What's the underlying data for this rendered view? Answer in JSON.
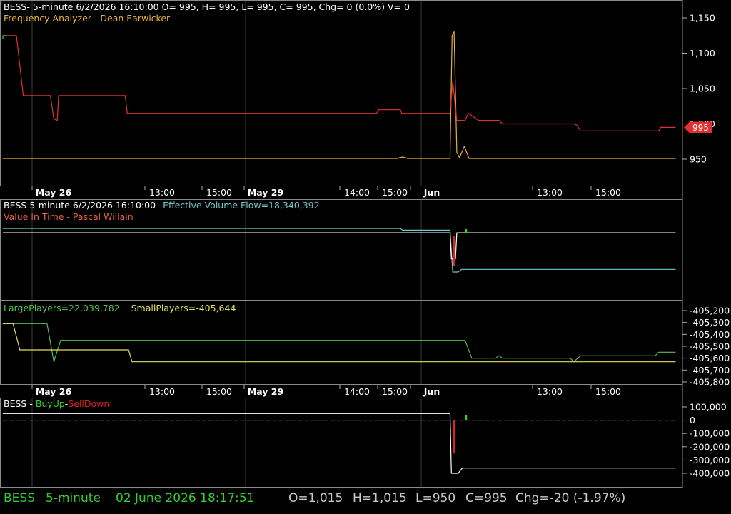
{
  "colors": {
    "background": "#000000",
    "frame": "#8a8a8a",
    "grid": "#3a3a3a",
    "price": "#e03030",
    "freq": "#e8b040",
    "evf": "#70c8c8",
    "vit": "#e03030",
    "large": "#50c050",
    "small": "#e0e060",
    "buy": "#30d030",
    "sell": "#e02020",
    "white": "#ffffff",
    "status_green": "#33cc33",
    "status_gray": "#c8c8c8"
  },
  "panels": {
    "price": {
      "header": "BESS- 5-minute 6/2/2026 16:10:00 O= 995, H= 995, L= 995, C= 995, Chg= 0 (0.0%) V= 0",
      "indicator": "Frequency Analyzer - Dean Earwicker",
      "y_ticks": [
        "1,150",
        "1,100",
        "1,050",
        "1,000",
        "950"
      ],
      "last_price": "995"
    },
    "flow": {
      "header_prefix": "BESS 5-minute  6/2/2026 16:10:00",
      "evf": "Effective Volume Flow=18,340,392",
      "vit": "Value In Time - Pascal Willain"
    },
    "players": {
      "large": "LargePlayers=22,039,782",
      "small": "SmallPlayers=-405,644",
      "y_ticks": [
        "-405,200",
        "-405,300",
        "-405,400",
        "-405,500",
        "-405,600",
        "-405,700",
        "-405,800"
      ]
    },
    "buysell": {
      "prefix": "BESS - ",
      "buy": "BuyUp",
      "dash": "-",
      "sell": "SellDown",
      "y_ticks": [
        "100,000",
        "0",
        "-100,000",
        "-200,000",
        "-300,000",
        "-400,000"
      ]
    }
  },
  "time_axis": [
    "May 26",
    "13:00",
    "15:00",
    "May 29",
    "14:00",
    "15:00",
    "Jun",
    "13:00",
    "15:00"
  ],
  "status": {
    "symbol": "BESS",
    "interval": "5-minute",
    "datetime": "02 June 2026 18:17:51",
    "open": "O=1,015",
    "high": "H=1,015",
    "low": "L=950",
    "close": "C=995",
    "change": "Chg=-20 (-1.97%)"
  },
  "chart_data": [
    {
      "type": "line",
      "title": "BESS- 5-minute 6/2/2026 16:10:00 O= 995, H= 995, L= 995, C= 995, Chg= 0 (0.0%) V= 0",
      "x_labels": [
        "May 26",
        "13:00",
        "15:00",
        "May 29",
        "14:00",
        "15:00",
        "Jun",
        "13:00",
        "15:00"
      ],
      "ylim": [
        925,
        1175
      ],
      "y_ticks": [
        1150,
        1100,
        1050,
        1000,
        950
      ],
      "series": [
        {
          "name": "BESS",
          "points": [
            [
              0,
              1125
            ],
            [
              2,
              1125
            ],
            [
              3,
              1040
            ],
            [
              7,
              1040
            ],
            [
              7.5,
              1007
            ],
            [
              8,
              1005
            ],
            [
              8.2,
              1040
            ],
            [
              18,
              1040
            ],
            [
              18.3,
              1015
            ],
            [
              55,
              1015
            ],
            [
              55.3,
              1020
            ],
            [
              58.5,
              1020
            ],
            [
              58.7,
              1015
            ],
            [
              65.8,
              1015
            ],
            [
              66.2,
              1060
            ],
            [
              66.8,
              1005
            ],
            [
              68,
              1005
            ],
            [
              68.5,
              1015
            ],
            [
              70,
              1005
            ],
            [
              73,
              1005
            ],
            [
              73.5,
              1000
            ],
            [
              84,
              1000
            ],
            [
              84.5,
              998
            ],
            [
              85,
              990
            ],
            [
              96.5,
              990
            ],
            [
              96.8,
              995
            ],
            [
              99,
              995
            ]
          ]
        },
        {
          "name": "Frequency Analyzer - Dean Earwicker",
          "points": [
            [
              0,
              951
            ],
            [
              58,
              951
            ],
            [
              58.8,
              953
            ],
            [
              59.6,
              951
            ],
            [
              65.8,
              951
            ],
            [
              66.1,
              1125
            ],
            [
              66.4,
              1130
            ],
            [
              66.8,
              960
            ],
            [
              67.2,
              952
            ],
            [
              67.9,
              968
            ],
            [
              68.6,
              951
            ],
            [
              99,
              951
            ]
          ]
        }
      ]
    },
    {
      "type": "line",
      "title": "BESS 5-minute  6/2/2026 16:10:00",
      "series": [
        {
          "name": "Effective Volume Flow=18,340,392",
          "points": [
            [
              0,
              18.55
            ],
            [
              58.5,
              18.55
            ],
            [
              58.8,
              18.53
            ],
            [
              65.8,
              18.53
            ],
            [
              66.2,
              18.05
            ],
            [
              67,
              18.05
            ],
            [
              67.5,
              18.08
            ],
            [
              99,
              18.08
            ]
          ]
        },
        {
          "name": "Value In Time - Pascal Willain",
          "points": [
            [
              0,
              18.5
            ],
            [
              65.8,
              18.5
            ],
            [
              66,
              18.2
            ],
            [
              66.6,
              18.2
            ],
            [
              66.8,
              18.5
            ],
            [
              99,
              18.5
            ]
          ]
        }
      ]
    },
    {
      "type": "line",
      "title": "LargePlayers / SmallPlayers",
      "ylim": [
        -405835,
        -405165
      ],
      "y_ticks": [
        -405200,
        -405300,
        -405400,
        -405500,
        -405600,
        -405700,
        -405800
      ],
      "series": [
        {
          "name": "LargePlayers=22,039,782",
          "points": [
            [
              0,
              -405310
            ],
            [
              6.5,
              -405310
            ],
            [
              7.5,
              -405630
            ],
            [
              8.5,
              -405450
            ],
            [
              68,
              -405450
            ],
            [
              69,
              -405600
            ],
            [
              72.5,
              -405600
            ],
            [
              73,
              -405580
            ],
            [
              73.5,
              -405600
            ],
            [
              83.5,
              -405600
            ],
            [
              84,
              -405630
            ],
            [
              85,
              -405580
            ],
            [
              96,
              -405580
            ],
            [
              96.5,
              -405550
            ],
            [
              99,
              -405550
            ]
          ]
        },
        {
          "name": "SmallPlayers=-405,644",
          "points": [
            [
              0,
              -405310
            ],
            [
              1.5,
              -405310
            ],
            [
              2.5,
              -405530
            ],
            [
              18.5,
              -405530
            ],
            [
              19,
              -405630
            ],
            [
              99,
              -405630
            ]
          ]
        }
      ]
    },
    {
      "type": "line",
      "title": "BESS - BuyUp-SellDown",
      "ylim": [
        -420000,
        125000
      ],
      "y_ticks": [
        100000,
        0,
        -100000,
        -200000,
        -300000,
        -400000
      ],
      "series": [
        {
          "name": "BuyUp",
          "points": [
            [
              0,
              50000
            ],
            [
              65.8,
              50000
            ],
            [
              66,
              -400000
            ],
            [
              67,
              -400000
            ],
            [
              67.6,
              -360000
            ],
            [
              99,
              -360000
            ]
          ]
        },
        {
          "name": "SellDown",
          "points": [
            [
              0,
              0
            ],
            [
              65.8,
              0
            ],
            [
              66,
              -250000
            ],
            [
              66.6,
              -250000
            ],
            [
              66.8,
              0
            ],
            [
              99,
              0
            ]
          ]
        }
      ]
    }
  ]
}
